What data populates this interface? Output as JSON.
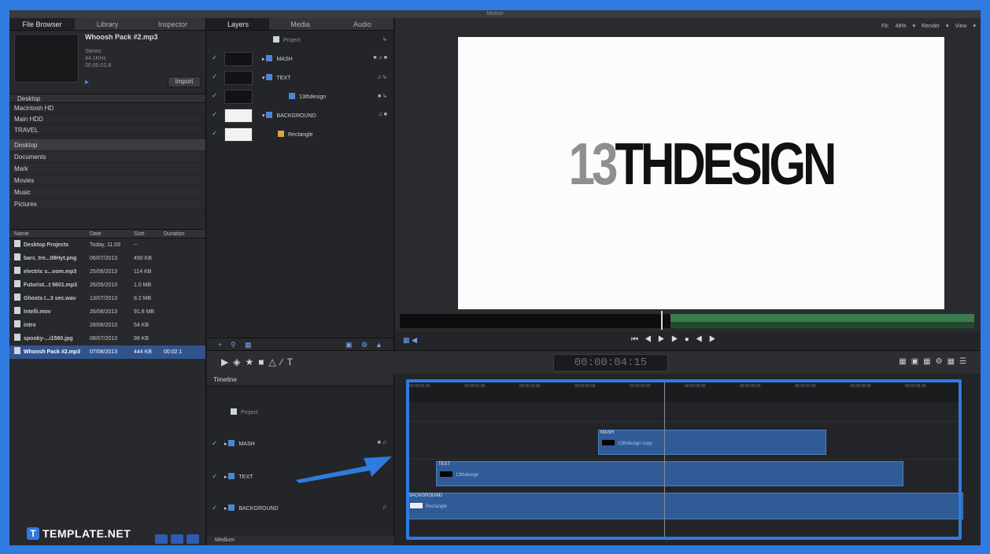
{
  "window": {
    "title": "Motion"
  },
  "left_panel": {
    "tabs": [
      "File Browser",
      "Library",
      "Inspector"
    ],
    "preview": {
      "name": "Whoosh Pack #2.mp3",
      "meta": [
        "Stereo",
        "44.1KHz",
        "00:00:02.8"
      ],
      "import_label": "Import"
    },
    "path_label": "Desktop",
    "volumes": [
      "Macintosh HD",
      "Main HDD",
      "TRAVEL"
    ],
    "places": [
      "Desktop",
      "Documents",
      "Mark",
      "Movies",
      "Music",
      "Pictures"
    ],
    "file_columns": [
      "Name",
      "Date",
      "Size",
      "Duration"
    ],
    "files": [
      {
        "name": "Desktop Projects",
        "date": "Today, 11:09",
        "size": "--",
        "duration": ""
      },
      {
        "name": "bars_tre...08Hyt.png",
        "date": "06/07/2013",
        "size": "490 KB",
        "duration": ""
      },
      {
        "name": "electric s...oom.mp3",
        "date": "25/06/2013",
        "size": "114 KB",
        "duration": ""
      },
      {
        "name": "Futurist...t 5601.mp3",
        "date": "26/05/2013",
        "size": "1.0 MB",
        "duration": ""
      },
      {
        "name": "Ghosts I...3 sec.wav",
        "date": "13/07/2013",
        "size": "8.2 MB",
        "duration": ""
      },
      {
        "name": "Intelli.mov",
        "date": "26/06/2013",
        "size": "91.8 MB",
        "duration": ""
      },
      {
        "name": "intro",
        "date": "28/06/2013",
        "size": "54 KB",
        "duration": ""
      },
      {
        "name": "spooky-...i1560.jpg",
        "date": "08/07/2013",
        "size": "98 KB",
        "duration": ""
      },
      {
        "name": "Whoosh Pack #2.mp3",
        "date": "07/06/2013",
        "size": "444 KB",
        "duration": "00:02.1"
      }
    ],
    "logo_text": "TEMPLATE.NET"
  },
  "layers_panel": {
    "tabs": [
      "Layers",
      "Media",
      "Audio"
    ],
    "project_label": "Project",
    "layers": [
      {
        "name": "MASH",
        "thumb": "dark"
      },
      {
        "name": "TEXT",
        "thumb": "dark"
      },
      {
        "name": "13thdesign",
        "thumb": "dark"
      },
      {
        "name": "BACKGROUND",
        "thumb": "white"
      },
      {
        "name": "Rectangle",
        "thumb": "white"
      }
    ]
  },
  "canvas": {
    "toolbar_options": [
      "Fit: 48%",
      "Render",
      "View"
    ],
    "brand_gray": "13",
    "brand_black": "THDESIGN"
  },
  "transport": {
    "timecode": "00:00:04:15"
  },
  "timeline": {
    "header": "Timeline",
    "project_label": "Project",
    "rows": [
      {
        "name": "MASH"
      },
      {
        "name": "TEXT"
      },
      {
        "name": "BACKGROUND"
      }
    ],
    "footer": "Medium",
    "ruler_ticks": [
      "00:00:00:00",
      "00:00:01:00",
      "00:00:02:00",
      "00:00:03:00",
      "00:00:04:00",
      "00:00:05:00",
      "00:00:06:00",
      "00:00:07:00",
      "00:00:08:00",
      "00:00:09:00"
    ],
    "clips": [
      {
        "track": "MASH",
        "label": "MASH",
        "sub": "13thdesign copy"
      },
      {
        "track": "TEXT",
        "label": "TEXT",
        "sub": "13thdesign"
      },
      {
        "track": "BACKGROUND",
        "label": "BACKGROUND",
        "sub": "Rectangle"
      }
    ]
  },
  "colors": {
    "accent": "#2f7be0",
    "clip": "#2f5c96"
  }
}
